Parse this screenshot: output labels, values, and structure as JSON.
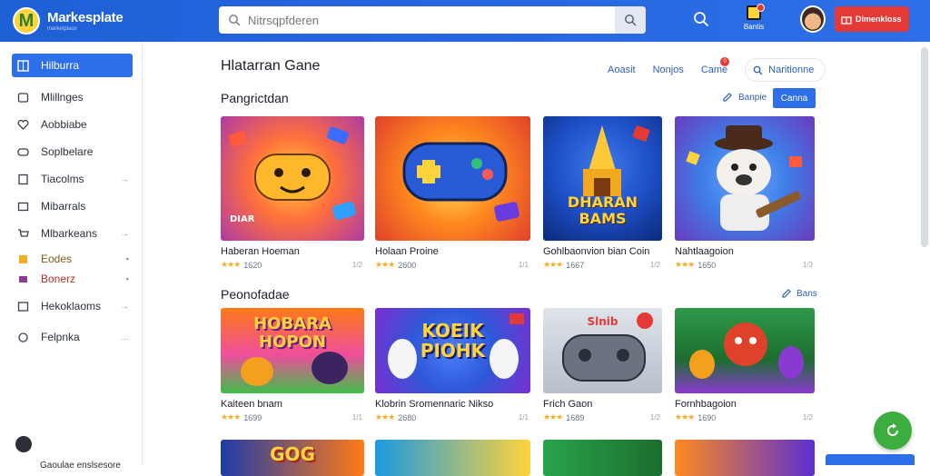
{
  "header": {
    "app_name": "Markesplate",
    "app_tagline": "marketplace",
    "search_placeholder": "Nitrsqpfderen",
    "notification_label": "Bantis",
    "cta_label": "Dimenkloss"
  },
  "sidebar": {
    "items": [
      {
        "label": "Hilburra",
        "active": true,
        "icon": "grid-icon"
      },
      {
        "label": "Mlillnges",
        "icon": "home-icon"
      },
      {
        "label": "Aobbiabe",
        "icon": "heart-icon"
      },
      {
        "label": "Soplbelare",
        "icon": "gamepad-icon"
      },
      {
        "label": "Tiacolms",
        "icon": "tag-icon",
        "arrow": "→"
      },
      {
        "label": "Mibarrals",
        "icon": "box-icon"
      },
      {
        "label": "Mlbarkeans",
        "icon": "cart-icon",
        "arrow": "→"
      },
      {
        "label": "Eodes",
        "icon": "code-icon",
        "arrow": "▪"
      },
      {
        "label": "Bonerz",
        "icon": "bookmark-icon",
        "arrow": "▪"
      },
      {
        "label": "Hekoklaoms",
        "icon": "list-icon",
        "arrow": "→"
      },
      {
        "label": "Felpnka",
        "icon": "settings-icon",
        "arrow": "…"
      }
    ],
    "footer": "Gaoulae enslsesore"
  },
  "main": {
    "title": "Hlatarran Gane",
    "tabs": [
      "Aoasit",
      "Nonjos",
      "Came"
    ],
    "tab_button": "Naritionne",
    "tab_badge": "0",
    "section1": {
      "title": "Pangrictdan",
      "link": "Banpie",
      "button": "Canna"
    },
    "section2": {
      "title": "Peonofadae",
      "link": "Bans"
    },
    "row1": [
      {
        "title": "Haberan Hoeman",
        "rating": "1620",
        "side": "1/2",
        "art": "DIAR",
        "colors": [
          "#ff6f3c",
          "#b03aa3"
        ]
      },
      {
        "title": "Holaan Proine",
        "rating": "2600",
        "side": "1/1",
        "art": "",
        "colors": [
          "#ff8a1f",
          "#e0412a"
        ]
      },
      {
        "title": "Gohlbaonvion bian Coin",
        "rating": "1667",
        "side": "1/2",
        "art": "DHARAN BAMS",
        "colors": [
          "#1e50c8",
          "#0b2a7a"
        ]
      },
      {
        "title": "Nahtlaagoion",
        "rating": "1650",
        "side": "1/3",
        "art": "",
        "colors": [
          "#3e7ee8",
          "#6a3bbd"
        ]
      }
    ],
    "row2": [
      {
        "title": "Kaiteen bnam",
        "rating": "1699",
        "side": "1/1",
        "art": "HOBARA HOPON",
        "colors": [
          "#ff7a18",
          "#a83ad1"
        ]
      },
      {
        "title": "Klobrin Sromennaric Nikso",
        "rating": "2680",
        "side": "1/1",
        "art": "KOEIK PIOHK",
        "colors": [
          "#2e59d8",
          "#7a2ed0"
        ]
      },
      {
        "title": "Frich Gaon",
        "rating": "1689",
        "side": "1/2",
        "art": "Slnib",
        "colors": [
          "#c8cfdc",
          "#8d96a8"
        ]
      },
      {
        "title": "Fornhbagoion",
        "rating": "1690",
        "side": "1/2",
        "art": "",
        "colors": [
          "#e0412a",
          "#1c7a3a"
        ]
      }
    ],
    "row3": [
      {
        "art": "GOG",
        "colors": [
          "#1e3ca8",
          "#ff7a18"
        ]
      },
      {
        "art": "",
        "colors": [
          "#1a9ae0",
          "#ffd43b"
        ]
      },
      {
        "art": "",
        "colors": [
          "#28a44a",
          "#1c6e2e"
        ]
      },
      {
        "art": "",
        "colors": [
          "#ff8a1f",
          "#5b2ed0"
        ]
      }
    ]
  }
}
